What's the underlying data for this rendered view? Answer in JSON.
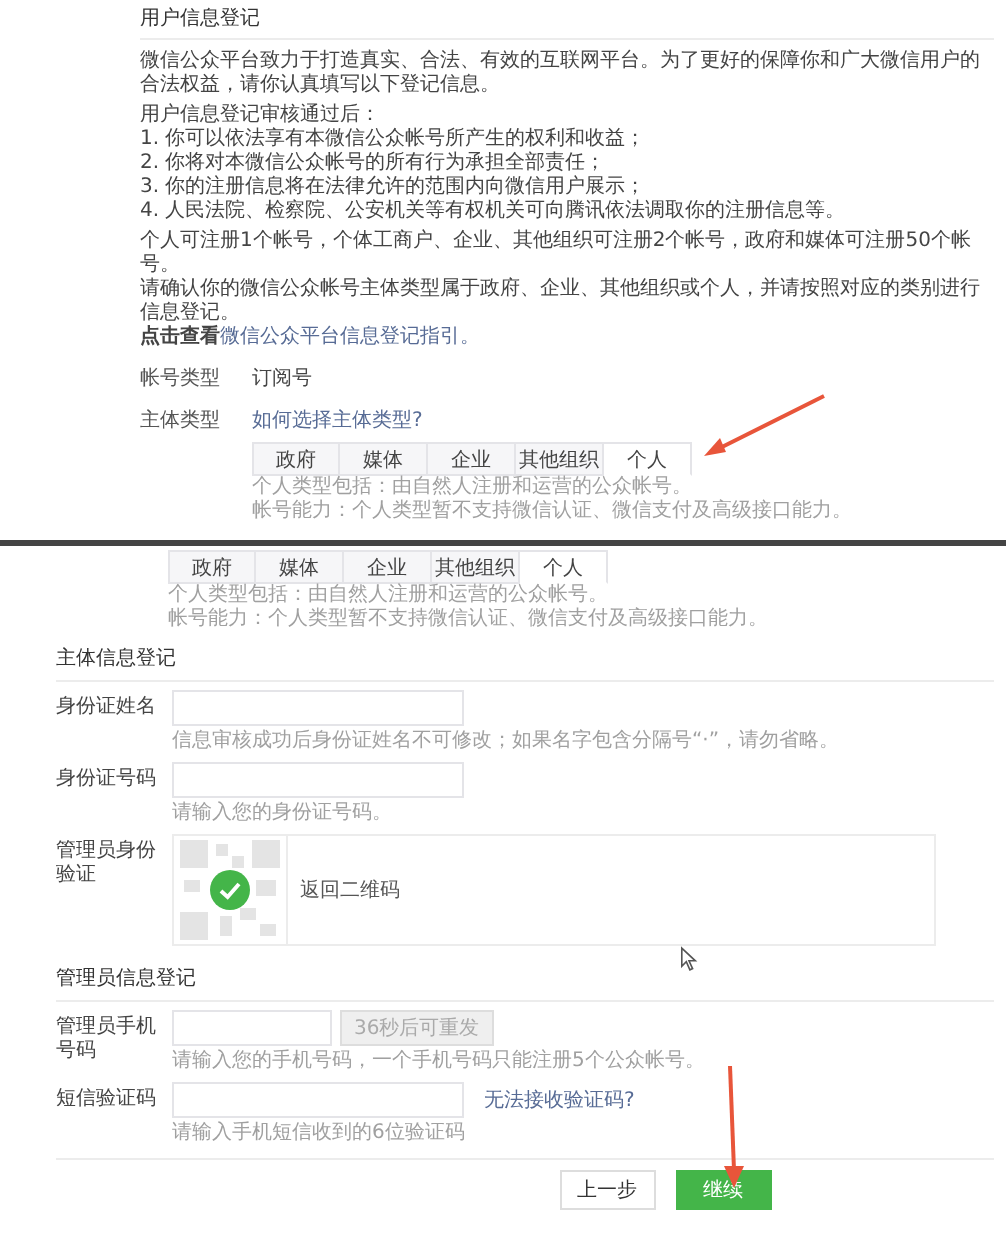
{
  "top_panel": {
    "section_title": "用户信息登记",
    "intro": "微信公众平台致力于打造真实、合法、有效的互联网平台。为了更好的保障你和广大微信用户的合法权益，请你认真填写以下登记信息。",
    "approval_heading": "用户信息登记审核通过后：",
    "approval_items": [
      "1. 你可以依法享有本微信公众帐号所产生的权利和收益；",
      "2. 你将对本微信公众帐号的所有行为承担全部责任；",
      "3. 你的注册信息将在法律允许的范围内向微信用户展示；",
      "4. 人民法院、检察院、公安机关等有权机关可向腾讯依法调取你的注册信息等。"
    ],
    "notes": [
      "个人可注册1个帐号，个体工商户、企业、其他组织可注册2个帐号，政府和媒体可注册50个帐号。",
      "请确认你的微信公众帐号主体类型属于政府、企业、其他组织或个人，并请按照对应的类别进行信息登记。"
    ],
    "guide": {
      "prefix": "点击查看",
      "link": "微信公众平台信息登记指引。"
    },
    "account_type": {
      "label": "帐号类型",
      "value": "订阅号"
    },
    "subject_type": {
      "label": "主体类型",
      "link": "如何选择主体类型?"
    },
    "subject_tabs": [
      {
        "label": "政府",
        "selected": false
      },
      {
        "label": "媒体",
        "selected": false
      },
      {
        "label": "企业",
        "selected": false
      },
      {
        "label": "其他组织",
        "selected": false
      },
      {
        "label": "个人",
        "selected": true
      }
    ],
    "subject_hints": [
      "个人类型包括：由自然人注册和运营的公众帐号。",
      "帐号能力：个人类型暂不支持微信认证、微信支付及高级接口能力。"
    ]
  },
  "bottom_panel": {
    "subject_tabs": [
      {
        "label": "政府",
        "selected": false
      },
      {
        "label": "媒体",
        "selected": false
      },
      {
        "label": "企业",
        "selected": false
      },
      {
        "label": "其他组织",
        "selected": false
      },
      {
        "label": "个人",
        "selected": true
      }
    ],
    "subject_hints": [
      "个人类型包括：由自然人注册和运营的公众帐号。",
      "帐号能力：个人类型暂不支持微信认证、微信支付及高级接口能力。"
    ],
    "sections": [
      {
        "title": "主体信息登记",
        "fields": [
          {
            "kind": "text",
            "label": "身份证姓名",
            "hint": "信息审核成功后身份证姓名不可修改；如果名字包含分隔号“·”，请勿省略。"
          },
          {
            "kind": "text",
            "label": "身份证号码",
            "hint": "请输入您的身份证号码。"
          },
          {
            "kind": "qr",
            "label": "管理员身份验证",
            "status": "返回二维码",
            "verified": true
          }
        ]
      },
      {
        "title": "管理员信息登记",
        "fields": [
          {
            "kind": "phone",
            "label": "管理员手机号码",
            "button": {
              "label": "36秒后可重发",
              "disabled": true
            },
            "hint": "请输入您的手机号码，一个手机号码只能注册5个公众帐号。"
          },
          {
            "kind": "sms",
            "label": "短信验证码",
            "link": "无法接收验证码?",
            "hint": "请输入手机短信收到的6位验证码"
          }
        ]
      }
    ],
    "buttons": [
      {
        "label": "上一步",
        "primary": false
      },
      {
        "label": "继续",
        "primary": true
      }
    ]
  }
}
